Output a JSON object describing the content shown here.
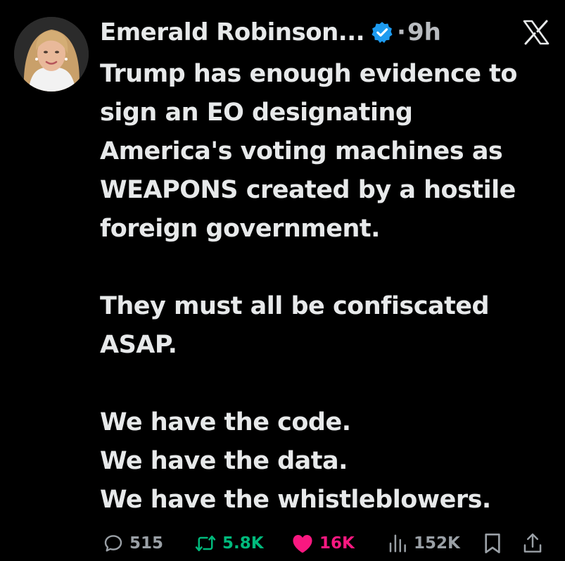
{
  "tweet": {
    "author": {
      "name": "Emerald Robinson...",
      "verified": true,
      "verified_color": "#1d9bf0"
    },
    "separator": "·",
    "time": "9h",
    "platform_logo": "x-logo-icon",
    "paragraphs": [
      {
        "lines": [
          "Trump has enough evidence to",
          "sign an EO designating",
          "America's voting machines as",
          "WEAPONS created by a hostile",
          "foreign government."
        ]
      },
      {
        "lines": [
          "They must all be confiscated",
          "ASAP."
        ]
      },
      {
        "lines": [
          "We have the code.",
          "We have the data.",
          "We have the whistleblowers."
        ]
      }
    ],
    "actions": {
      "replies": {
        "icon": "reply-icon",
        "count": "515",
        "color": "#9aa0a6"
      },
      "retweets": {
        "icon": "retweet-icon",
        "count": "5.8K",
        "color": "#00ba7c"
      },
      "likes": {
        "icon": "heart-icon",
        "count": "16K",
        "color": "#f91880",
        "liked": true
      },
      "views": {
        "icon": "views-icon",
        "count": "152K",
        "color": "#9aa0a6"
      },
      "bookmark": {
        "icon": "bookmark-icon"
      },
      "share": {
        "icon": "share-icon"
      }
    }
  },
  "colors": {
    "background": "#000000",
    "text": "#e7e9ea",
    "secondary_text": "#b9bcc0"
  }
}
